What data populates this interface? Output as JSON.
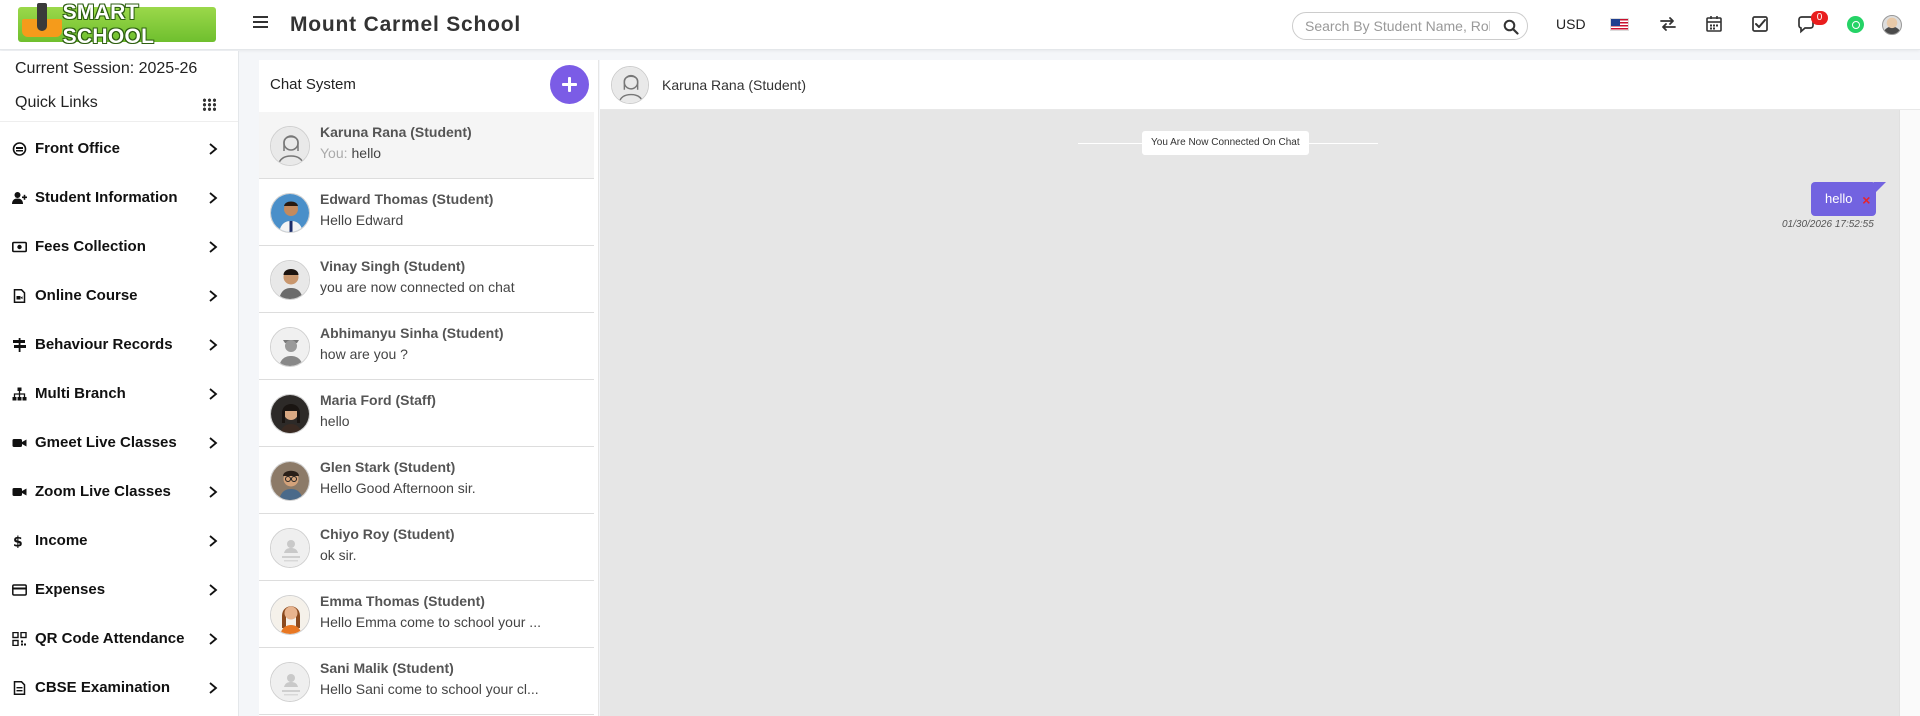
{
  "app": {
    "logo_text": "SMART SCHOOL",
    "school_name": "Mount Carmel School"
  },
  "header": {
    "search_placeholder": "Search By Student Name, Roll Number, Enroll Number, National Id, Local Id Etc.",
    "currency": "USD",
    "notification_count": "0",
    "icons": [
      "menu-icon",
      "search-icon",
      "us-flag-icon",
      "transfer-icon",
      "calendar-icon",
      "task-check-icon",
      "chat-icon",
      "whatsapp-icon",
      "user-avatar"
    ]
  },
  "sidebar": {
    "session": "Current Session: 2025-26",
    "quick_links": "Quick Links",
    "items": [
      {
        "label": "Front Office",
        "icon": "front-office-icon"
      },
      {
        "label": "Student Information",
        "icon": "user-plus-icon"
      },
      {
        "label": "Fees Collection",
        "icon": "money-icon"
      },
      {
        "label": "Online Course",
        "icon": "file-video-icon"
      },
      {
        "label": "Behaviour Records",
        "icon": "signpost-icon"
      },
      {
        "label": "Multi Branch",
        "icon": "sitemap-icon"
      },
      {
        "label": "Gmeet Live Classes",
        "icon": "video-camera-icon"
      },
      {
        "label": "Zoom Live Classes",
        "icon": "video-camera-icon"
      },
      {
        "label": "Income",
        "icon": "dollar-icon"
      },
      {
        "label": "Expenses",
        "icon": "credit-card-icon"
      },
      {
        "label": "QR Code Attendance",
        "icon": "qrcode-icon"
      },
      {
        "label": "CBSE Examination",
        "icon": "file-icon"
      }
    ]
  },
  "chat": {
    "title": "Chat System",
    "contacts": [
      {
        "name": "Karuna Rana (Student)",
        "you": "You:",
        "message": "hello",
        "avatar": "placeholder-female"
      },
      {
        "name": "Edward Thomas (Student)",
        "you": "",
        "message": "Hello Edward",
        "avatar": "photo-blue"
      },
      {
        "name": "Vinay Singh (Student)",
        "you": "",
        "message": "you are now connected on chat",
        "avatar": "photo-light"
      },
      {
        "name": "Abhimanyu Sinha (Student)",
        "you": "",
        "message": "how are you ?",
        "avatar": "placeholder-male"
      },
      {
        "name": "Maria Ford (Staff)",
        "you": "",
        "message": "hello",
        "avatar": "photo-dark"
      },
      {
        "name": "Glen Stark (Student)",
        "you": "",
        "message": "Hello Good Afternoon sir.",
        "avatar": "photo-glasses"
      },
      {
        "name": "Chiyo Roy (Student)",
        "you": "",
        "message": "ok sir.",
        "avatar": "no-image"
      },
      {
        "name": "Emma Thomas (Student)",
        "you": "",
        "message": "Hello Emma come to school your ...",
        "avatar": "photo-orange"
      },
      {
        "name": "Sani Malik (Student)",
        "you": "",
        "message": "Hello Sani come to school your cl...",
        "avatar": "no-image"
      }
    ],
    "active": {
      "name": "Karuna Rana (Student)",
      "connected_notice": "You Are Now Connected On Chat",
      "messages": [
        {
          "text": "hello",
          "time": "01/30/2026 17:52:55",
          "delete": "×"
        }
      ]
    }
  }
}
